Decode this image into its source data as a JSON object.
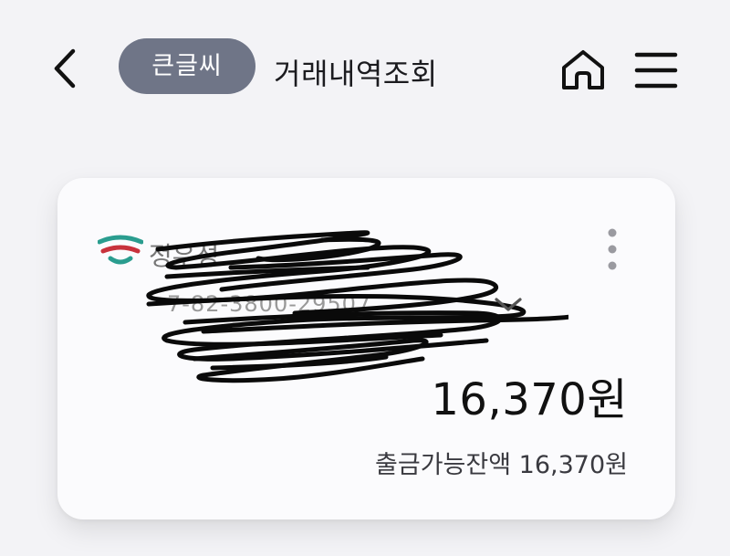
{
  "header": {
    "back_icon": "chevron-left-icon",
    "big_font_label": "큰글씨",
    "title": "거래내역조회",
    "home_icon": "home-icon",
    "menu_icon": "hamburger-menu-icon"
  },
  "account_card": {
    "bank_logo_icon": "bank-logo-icon",
    "account_name": "정우성",
    "account_number": "7-82-3800-29507",
    "redacted": true,
    "expand_icon": "chevron-down-icon",
    "more_icon": "more-vertical-icon",
    "balance": "16,370원",
    "available_label": "출금가능잔액",
    "available_amount": "16,370원"
  },
  "colors": {
    "background": "#f3f3f6",
    "pill": "#6f7587",
    "logo_teal": "#2a9d8f",
    "logo_red": "#c8323c"
  }
}
